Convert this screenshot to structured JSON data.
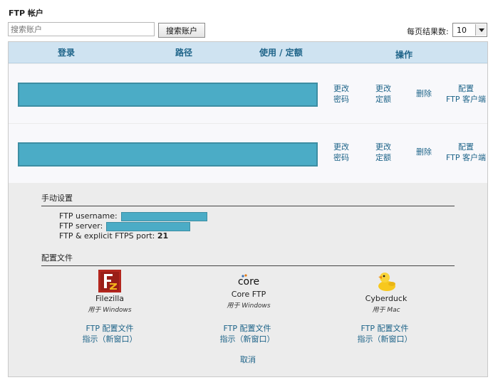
{
  "title": "FTP 帐户",
  "search": {
    "placeholder": "搜索账户",
    "button": "搜索账户"
  },
  "per_page": {
    "label": "每页结果数:",
    "value": "10"
  },
  "columns": [
    "登录",
    "路径",
    "使用 / 定额",
    "操作"
  ],
  "rows": [
    {
      "actions": [
        "更改\n密码",
        "更改\n定额",
        "删除",
        "配置\nFTP 客户端"
      ]
    },
    {
      "actions": [
        "更改\n密码",
        "更改\n定额",
        "删除",
        "配置\nFTP 客户端"
      ]
    }
  ],
  "manual": {
    "title": "手动设置",
    "username_label": "FTP username:",
    "server_label": "FTP server:",
    "port_label": "FTP & explicit FTPS port:",
    "port_value": "21"
  },
  "config": {
    "title": "配置文件",
    "clients": [
      {
        "name": "Filezilla",
        "os": "用于 Windows",
        "icon": "filezilla-icon",
        "file_link": "FTP 配置文件",
        "guide_link": "指示（新窗口）"
      },
      {
        "name": "Core FTP",
        "os": "用于 Windows",
        "icon": "coreftp-icon",
        "file_link": "FTP 配置文件",
        "guide_link": "指示（新窗口）"
      },
      {
        "name": "Cyberduck",
        "os": "用于 Mac",
        "icon": "cyberduck-icon",
        "file_link": "FTP 配置文件",
        "guide_link": "指示（新窗口）"
      }
    ]
  },
  "cancel": "取消",
  "colors": {
    "header_bg": "#cfe3f1",
    "link": "#1e6489",
    "redacted": "#4bacc6"
  }
}
